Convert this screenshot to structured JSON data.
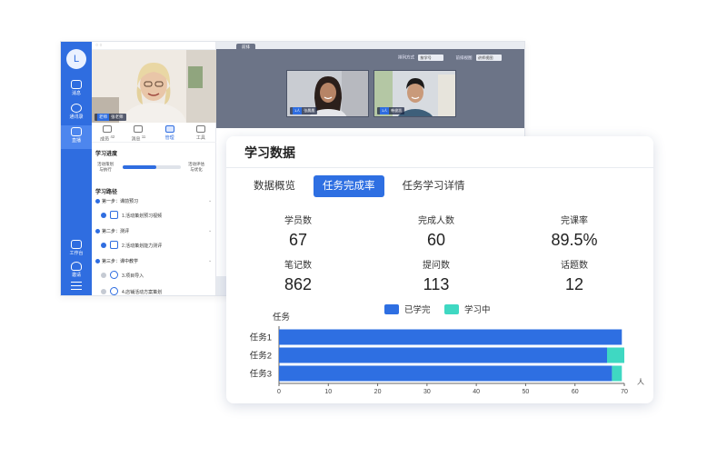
{
  "app": {
    "rail": {
      "avatar": "L",
      "items": [
        {
          "label": "消息",
          "active": false
        },
        {
          "label": "通讯录",
          "active": false
        },
        {
          "label": "直播",
          "active": true
        },
        {
          "label": "工作台",
          "active": false
        },
        {
          "label": "邀请",
          "active": false
        }
      ]
    },
    "teacher": {
      "badge": "老师",
      "name": "张老师"
    },
    "side_tabs": [
      {
        "label": "成员",
        "count": "42",
        "active": false
      },
      {
        "label": "消息",
        "count": "11",
        "active": false
      },
      {
        "label": "管理",
        "count": "",
        "active": true
      },
      {
        "label": "工具",
        "count": "",
        "active": false
      }
    ],
    "progress": {
      "title": "学习进度",
      "left": "活动策划与执行",
      "right": "活动评估与优化",
      "fraction": 0.58
    },
    "path": {
      "title": "学习路径",
      "steps": [
        {
          "label": "第一步：课前预习",
          "tasks": [
            {
              "label": "1.活动策划预习视频",
              "done": true
            }
          ]
        },
        {
          "label": "第二步：测评",
          "tasks": [
            {
              "label": "2.活动策划能力测评",
              "done": true
            }
          ]
        },
        {
          "label": "第三步：课中教学",
          "tasks": [
            {
              "label": "3.项目导入",
              "done": false
            },
            {
              "label": "4.店铺活动方案策划",
              "done": false
            }
          ]
        }
      ]
    },
    "main": {
      "tab": "前排",
      "sort_label": "排列方式",
      "sort_value": "按学号",
      "view_label": "前排视图",
      "view_value": "讲师视图",
      "students": [
        {
          "badge": "1人",
          "name": "张晨晨"
        },
        {
          "badge": "1人",
          "name": "韩俊凯"
        }
      ]
    }
  },
  "card": {
    "title": "学习数据",
    "tabs": [
      {
        "label": "数据概览",
        "active": false
      },
      {
        "label": "任务完成率",
        "active": true
      },
      {
        "label": "任务学习详情",
        "active": false
      }
    ],
    "stats": [
      {
        "label": "学员数",
        "value": "67"
      },
      {
        "label": "完成人数",
        "value": "60"
      },
      {
        "label": "完课率",
        "value": "89.5%"
      },
      {
        "label": "笔记数",
        "value": "862"
      },
      {
        "label": "提问数",
        "value": "113"
      },
      {
        "label": "话题数",
        "value": "12"
      }
    ]
  },
  "colors": {
    "primary": "#2e6fe2",
    "teal": "#3fd8c2",
    "rail": "#2f6de0"
  },
  "chart_data": {
    "type": "bar",
    "orientation": "horizontal",
    "stacked": true,
    "ylabel": "任务",
    "xlabel": "人",
    "categories": [
      "任务1",
      "任务2",
      "任务3"
    ],
    "series": [
      {
        "name": "已学完",
        "color": "#2e6fe2",
        "values": [
          69.5,
          66.5,
          67.5
        ]
      },
      {
        "name": "学习中",
        "color": "#3fd8c2",
        "values": [
          0,
          3.5,
          2
        ]
      }
    ],
    "xlim": [
      0,
      70
    ],
    "xticks": [
      0,
      10,
      20,
      30,
      40,
      50,
      60,
      70
    ],
    "legend": "top-center",
    "grid": false
  }
}
